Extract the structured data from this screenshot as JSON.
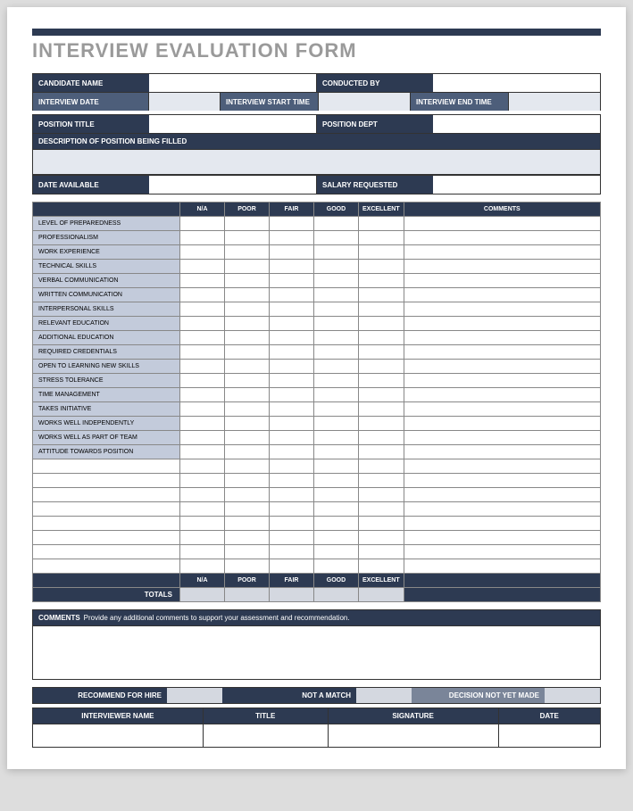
{
  "title": "INTERVIEW EVALUATION FORM",
  "header": {
    "candidate_name": "CANDIDATE NAME",
    "conducted_by": "CONDUCTED BY",
    "interview_date": "INTERVIEW DATE",
    "interview_start": "INTERVIEW START TIME",
    "interview_end": "INTERVIEW END TIME",
    "position_title": "POSITION TITLE",
    "position_dept": "POSITION DEPT",
    "description": "DESCRIPTION OF POSITION BEING FILLED",
    "date_available": "DATE AVAILABLE",
    "salary_requested": "SALARY REQUESTED"
  },
  "eval": {
    "cols": {
      "na": "N/A",
      "poor": "POOR",
      "fair": "FAIR",
      "good": "GOOD",
      "excellent": "EXCELLENT",
      "comments": "COMMENTS"
    },
    "criteria": [
      "LEVEL OF PREPAREDNESS",
      "PROFESSIONALISM",
      "WORK EXPERIENCE",
      "TECHNICAL SKILLS",
      "VERBAL COMMUNICATION",
      "WRITTEN COMMUNICATION",
      "INTERPERSONAL SKILLS",
      "RELEVANT EDUCATION",
      "ADDITIONAL EDUCATION",
      "REQUIRED CREDENTIALS",
      "OPEN TO LEARNING NEW SKILLS",
      "STRESS TOLERANCE",
      "TIME MANAGEMENT",
      "TAKES INITIATIVE",
      "WORKS WELL INDEPENDENTLY",
      "WORKS WELL AS PART OF TEAM",
      "ATTITUDE TOWARDS POSITION"
    ],
    "totals": "TOTALS"
  },
  "comments": {
    "label": "COMMENTS",
    "text": "Provide any additional comments to support your assessment and recommendation."
  },
  "rec": {
    "hire": "RECOMMEND FOR HIRE",
    "not_match": "NOT A MATCH",
    "undecided": "DECISION NOT YET MADE"
  },
  "sig": {
    "interviewer": "INTERVIEWER NAME",
    "title": "TITLE",
    "signature": "SIGNATURE",
    "date": "DATE"
  }
}
